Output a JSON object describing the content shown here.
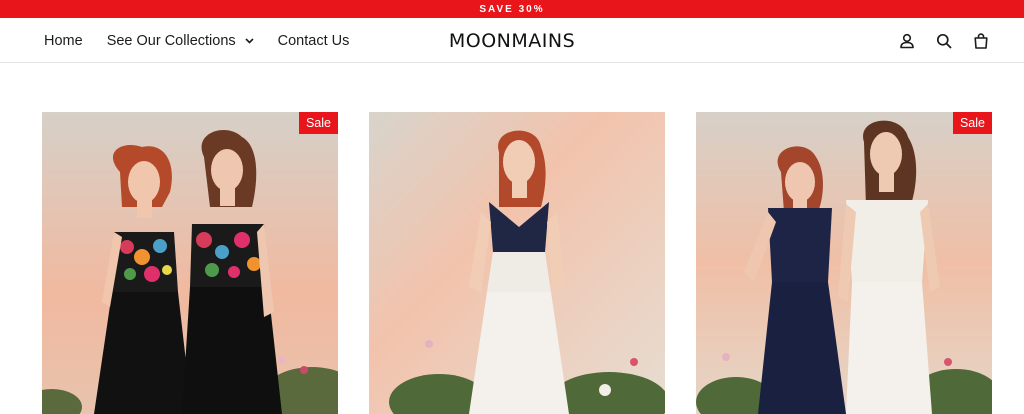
{
  "colors": {
    "accent": "#e8161b",
    "text": "#1c1c1c"
  },
  "announcement": {
    "text": "SAVE 30%"
  },
  "nav": {
    "home": "Home",
    "collections": "See Our Collections",
    "contact": "Contact Us"
  },
  "brand": {
    "name": "MOONMAINS"
  },
  "header_icons": [
    "account-icon",
    "search-icon",
    "cart-icon"
  ],
  "products": [
    {
      "badge": "Sale",
      "image": "two women in black dresses with floral embroidered bodices"
    },
    {
      "badge": "",
      "image": "woman in white dress with navy halter top"
    },
    {
      "badge": "Sale",
      "image": "two women in navy and white gowns"
    }
  ]
}
